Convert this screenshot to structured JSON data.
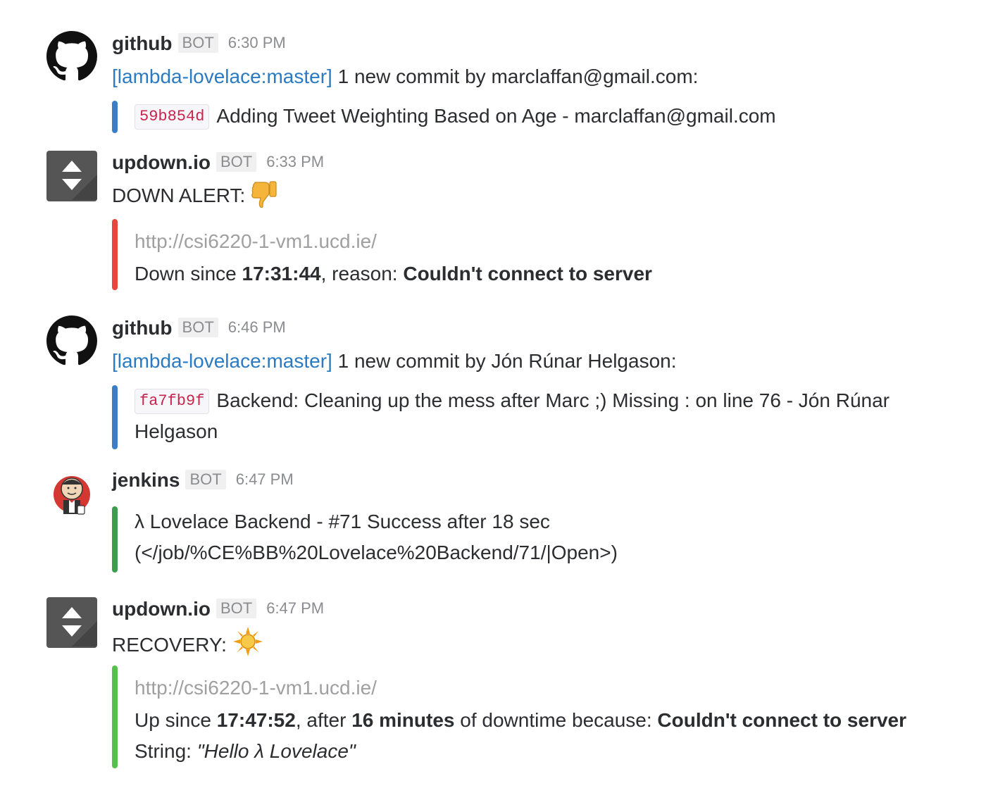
{
  "messages": [
    {
      "user": "github",
      "badge": "BOT",
      "time": "6:30 PM",
      "text_link": "[lambda-lovelace:master]",
      "text_rest": "1 new commit by marclaffan@gmail.com:",
      "commit_hash": "59b854d",
      "commit_msg": "Adding Tweet Weighting Based on Age - marclaffan@gmail.com",
      "bar_color": "#3b7ec8"
    },
    {
      "user": "updown.io",
      "badge": "BOT",
      "time": "6:33 PM",
      "text": "DOWN ALERT:",
      "emoji": "thumbs-down-icon",
      "url": "http://csi6220-1-vm1.ucd.ie/",
      "status_prefix": "Down since",
      "status_time": "17:31:44",
      "status_mid": ", reason:",
      "status_reason": "Couldn't connect to server",
      "bar_color": "#e8453c"
    },
    {
      "user": "github",
      "badge": "BOT",
      "time": "6:46 PM",
      "text_link": "[lambda-lovelace:master]",
      "text_rest": "1 new commit by Jón Rúnar Helgason:",
      "commit_hash": "fa7fb9f",
      "commit_msg": "Backend: Cleaning up the mess after Marc ;) Missing : on line 76 - Jón Rúnar",
      "commit_msg_2": "Helgason",
      "bar_color": "#3b7ec8"
    },
    {
      "user": "jenkins",
      "badge": "BOT",
      "time": "6:47 PM",
      "line1": "λ Lovelace Backend - #71 Success after 18 sec",
      "line2": "(</job/%CE%BB%20Lovelace%20Backend/71/|Open>)",
      "bar_color": "#3a9e4c"
    },
    {
      "user": "updown.io",
      "badge": "BOT",
      "time": "6:47 PM",
      "text": "RECOVERY:",
      "emoji": "sun-icon",
      "url": "http://csi6220-1-vm1.ucd.ie/",
      "up_prefix": "Up since",
      "up_time": "17:47:52",
      "up_mid": ", after",
      "up_duration": "16 minutes",
      "up_mid2": "of downtime because:",
      "up_reason": "Couldn't connect to server",
      "string_label": "String:",
      "string_value": "\"Hello λ Lovelace\"",
      "bar_color": "#53c24b"
    }
  ]
}
